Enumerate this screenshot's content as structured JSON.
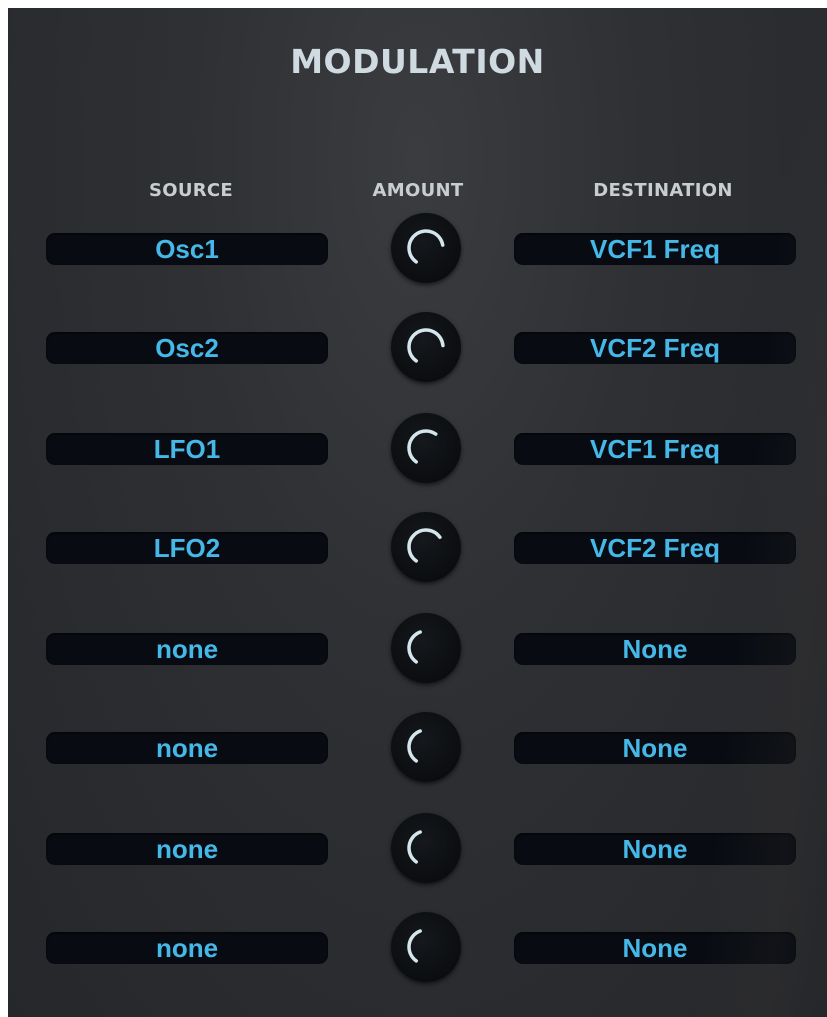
{
  "title": "MODULATION",
  "headers": {
    "source": "SOURCE",
    "amount": "AMOUNT",
    "destination": "DESTINATION"
  },
  "colors": {
    "value_text": "#45b8e8",
    "knob_arc": "#d4e6ec"
  },
  "rows": [
    {
      "source": "Osc1",
      "destination": "VCF1 Freq",
      "amount_arc_deg": 225
    },
    {
      "source": "Osc2",
      "destination": "VCF2 Freq",
      "amount_arc_deg": 230
    },
    {
      "source": "LFO1",
      "destination": "VCF1 Freq",
      "amount_arc_deg": 180
    },
    {
      "source": "LFO2",
      "destination": "VCF2 Freq",
      "amount_arc_deg": 200
    },
    {
      "source": "none",
      "destination": "None",
      "amount_arc_deg": 125
    },
    {
      "source": "none",
      "destination": "None",
      "amount_arc_deg": 125
    },
    {
      "source": "none",
      "destination": "None",
      "amount_arc_deg": 125
    },
    {
      "source": "none",
      "destination": "None",
      "amount_arc_deg": 125
    }
  ]
}
